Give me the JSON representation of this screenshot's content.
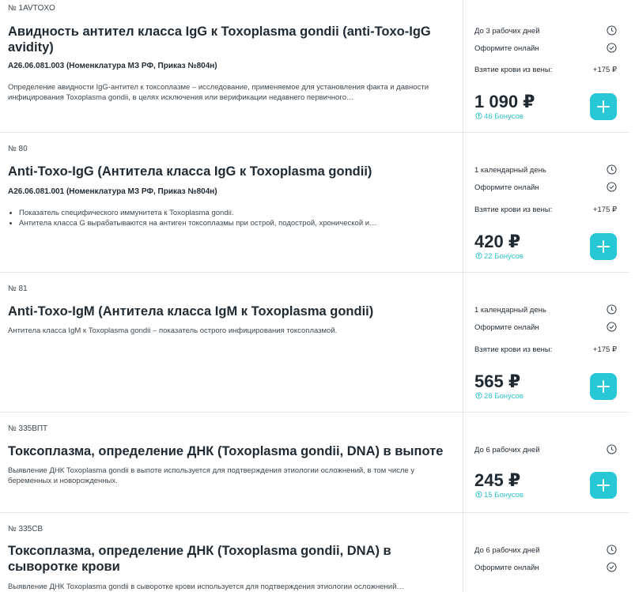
{
  "accent_color": "#28c7d6",
  "bonus_color": "#2ec3c8",
  "items": [
    {
      "code": "№ 1AVTOXO",
      "title": "Авидность антител класса IgG к Toxoplasma gondii (anti-Toxo-IgG avidity)",
      "nomenclature": "A26.06.081.003 (Номенклатура МЗ РФ, Приказ №804н)",
      "description": "Определение авидности IgG-антител к токсоплазме – исследование, применяемое для установления факта и давности инфицирования Toxoplasma gondii, в целях исключения или верификации недавнего первичного…",
      "term": "До 3 рабочих дней",
      "order_online": "Оформите онлайн",
      "blood_label": "Взятие крови из вены:",
      "blood_price": "+175 ₽",
      "price": "1 090 ₽",
      "bonus": "46 Бонусов"
    },
    {
      "code": "№ 80",
      "title": "Anti-Toxo-IgG (Антитела класса IgG к Toxoplasma gondii)",
      "nomenclature": "A26.06.081.001 (Номенклатура МЗ РФ, Приказ №804н)",
      "bullets": [
        "Показатель специфического иммунитета к Toxoplasma gondii.",
        "Антитела класса G вырабатываются на антиген токсоплазмы при острой, подострой, хронической и…"
      ],
      "term": "1 календарный день",
      "order_online": "Оформите онлайн",
      "blood_label": "Взятие крови из вены:",
      "blood_price": "+175 ₽",
      "price": "420 ₽",
      "bonus": "22 Бонусов"
    },
    {
      "code": "№ 81",
      "title": "Anti-Toxo-IgM (Антитела класса IgM к Toxoplasma gondii)",
      "description": "Антитела класса IgM к Toxoplasma gondii – показатель острого инфицирования токсоплазмой.",
      "term": "1 календарный день",
      "order_online": "Оформите онлайн",
      "blood_label": "Взятие крови из вены:",
      "blood_price": "+175 ₽",
      "price": "565 ₽",
      "bonus": "28 Бонусов"
    },
    {
      "code": "№ 335ВПТ",
      "title": "Токсоплазма, определение ДНК (Toxoplasma gondii, DNA) в выпоте",
      "description": "Выявление ДНК Toxoplasma gondii в выпоте используется для подтверждения этиологии осложнений, в том числе у беременных и новорожденных.",
      "term": "До 6 рабочих дней",
      "price": "245 ₽",
      "bonus": "15 Бонусов"
    },
    {
      "code": "№ 335СВ",
      "title": "Токсоплазма, определение ДНК (Toxoplasma gondii, DNA) в сыворотке крови",
      "description": "Выявление ДНК Toxoplasma gondii в сыворотке крови используется для подтверждения этиологии осложнений…",
      "term": "До 6 рабочих дней",
      "order_online": "Оформите онлайн"
    }
  ]
}
